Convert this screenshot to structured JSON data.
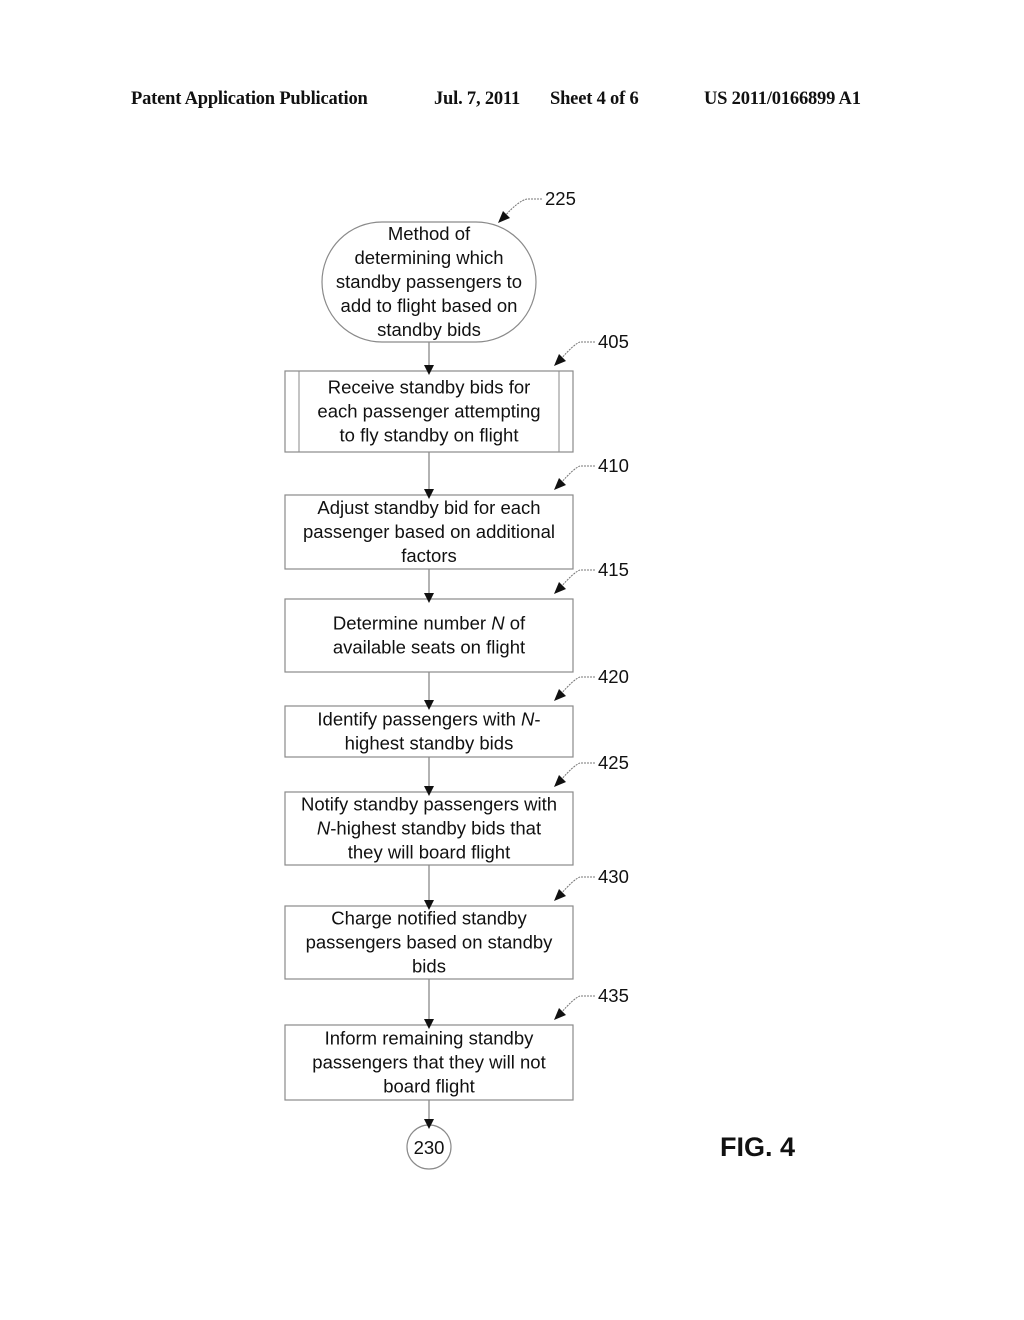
{
  "header": {
    "publication": "Patent Application Publication",
    "date": "Jul. 7, 2011",
    "sheet": "Sheet 4 of 6",
    "number": "US 2011/0166899 A1"
  },
  "figure_label": "FIG. 4",
  "flowchart": {
    "start": {
      "ref": "225",
      "shape": "terminator",
      "lines": [
        "Method of",
        "determining which",
        "standby passengers to",
        "add to flight based on",
        "standby bids"
      ]
    },
    "steps": [
      {
        "ref": "405",
        "shape": "predefined-process",
        "lines": [
          [
            "Receive standby bids for"
          ],
          [
            "each passenger attempting"
          ],
          [
            "to fly standby on flight"
          ]
        ]
      },
      {
        "ref": "410",
        "shape": "process",
        "lines": [
          [
            "Adjust standby bid for each"
          ],
          [
            "passenger based on additional"
          ],
          [
            "factors"
          ]
        ]
      },
      {
        "ref": "415",
        "shape": "process",
        "lines": [
          [
            "Determine number ",
            {
              "i": "N"
            },
            " of"
          ],
          [
            "available seats on flight"
          ]
        ]
      },
      {
        "ref": "420",
        "shape": "process",
        "lines": [
          [
            "Identify passengers with  ",
            {
              "i": "N"
            },
            "-"
          ],
          [
            "highest standby bids"
          ]
        ]
      },
      {
        "ref": "425",
        "shape": "process",
        "lines": [
          [
            "Notify standby passengers with"
          ],
          [
            {
              "i": "N"
            },
            "-highest standby bids that"
          ],
          [
            "they will board flight"
          ]
        ]
      },
      {
        "ref": "430",
        "shape": "process",
        "lines": [
          [
            "Charge notified standby"
          ],
          [
            "passengers based on standby"
          ],
          [
            "bids"
          ]
        ]
      },
      {
        "ref": "435",
        "shape": "process",
        "lines": [
          [
            "Inform remaining standby"
          ],
          [
            "passengers that they will not"
          ],
          [
            "board flight"
          ]
        ]
      }
    ],
    "end": {
      "ref": "230",
      "shape": "connector"
    }
  },
  "colors": {
    "line": "#8a8a8a",
    "text": "#111111",
    "arrow": "#111111"
  }
}
